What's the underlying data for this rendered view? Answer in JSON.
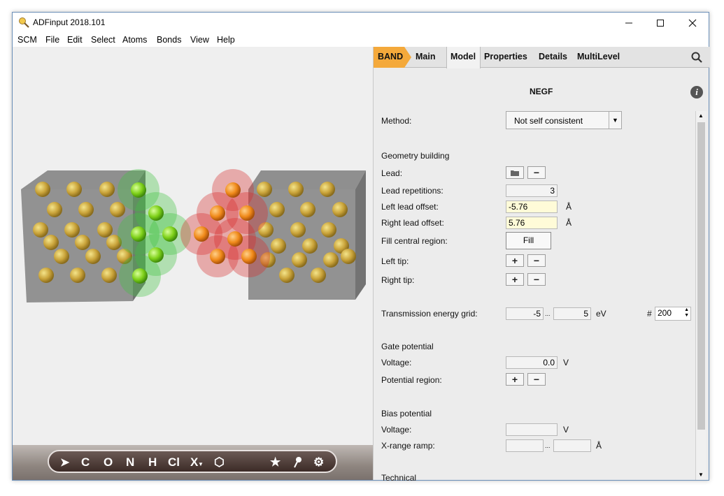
{
  "window": {
    "title": "ADFinput 2018.101"
  },
  "menu": [
    "SCM",
    "File",
    "Edit",
    "Select",
    "Atoms",
    "Bonds",
    "View",
    "Help"
  ],
  "tabs": {
    "band": "BAND",
    "items": [
      "Main",
      "Model",
      "Properties",
      "Details",
      "MultiLevel"
    ],
    "active": "Model"
  },
  "panel": {
    "heading": "NEGF",
    "method_label": "Method:",
    "method_value": "Not self consistent",
    "geometry_heading": "Geometry building",
    "lead_label": "Lead:",
    "lead_reps_label": "Lead repetitions:",
    "lead_reps_value": "3",
    "left_offset_label": "Left lead offset:",
    "left_offset_value": "-5.76",
    "right_offset_label": "Right lead offset:",
    "right_offset_value": "5.76",
    "offset_unit": "Å",
    "fill_label": "Fill central region:",
    "fill_button": "Fill",
    "left_tip_label": "Left tip:",
    "right_tip_label": "Right tip:",
    "trans_label": "Transmission energy grid:",
    "trans_min": "-5",
    "trans_max": "5",
    "range_sep": "...",
    "trans_unit": "eV",
    "trans_hash": "#",
    "trans_count": "200",
    "gate_heading": "Gate potential",
    "gate_voltage_label": "Voltage:",
    "gate_voltage_value": "0.0",
    "volt_unit": "V",
    "potential_region_label": "Potential region:",
    "bias_heading": "Bias potential",
    "bias_voltage_label": "Voltage:",
    "xrange_label": "X-range ramp:",
    "xrange_unit": "Å",
    "technical_heading": "Technical",
    "plus": "+",
    "minus": "−"
  },
  "toolbar": {
    "tools": [
      "C",
      "O",
      "N",
      "H",
      "Cl",
      "X",
      "★"
    ]
  }
}
